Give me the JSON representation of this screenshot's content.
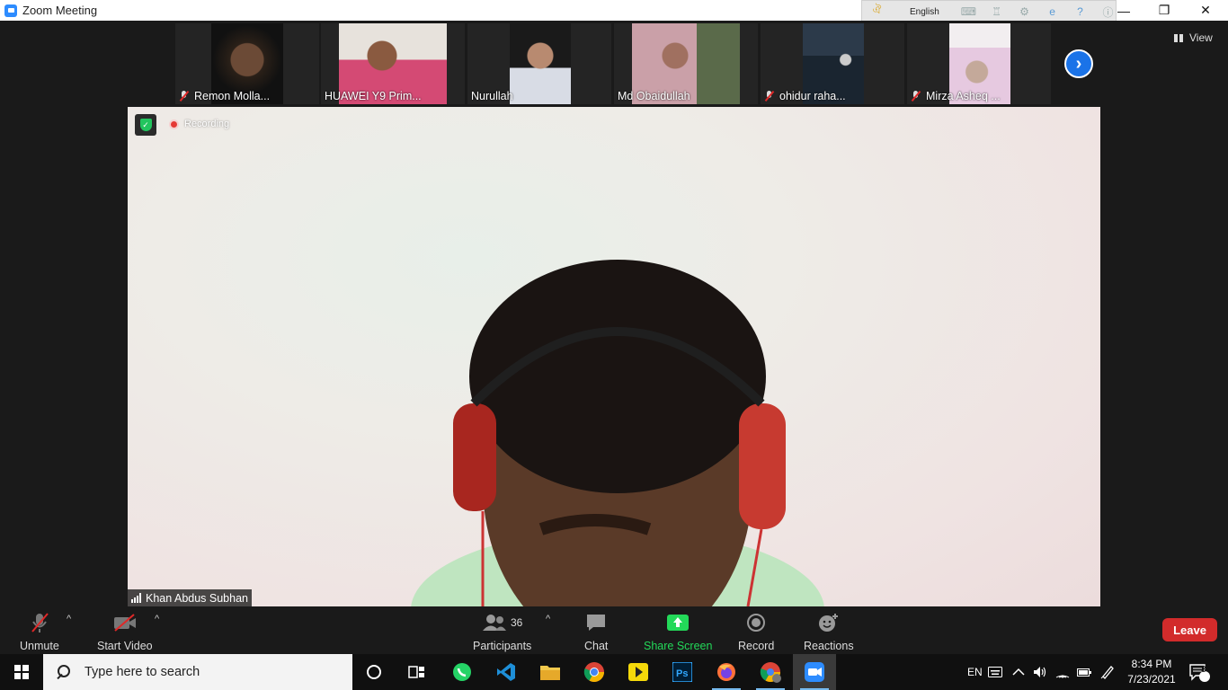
{
  "window": {
    "title": "Zoom Meeting",
    "language": "English",
    "minimize": "—",
    "restore": "❐",
    "close": "✕"
  },
  "participants_strip": [
    {
      "name": "Remon Molla...",
      "muted": true
    },
    {
      "name": "HUAWEI Y9 Prim...",
      "muted": false
    },
    {
      "name": "Nurullah",
      "muted": false
    },
    {
      "name": "Md Obaidullah",
      "muted": false
    },
    {
      "name": "ohidur raha...",
      "muted": true
    },
    {
      "name": "Mirza Asheq ...",
      "muted": true
    }
  ],
  "view_label": "View",
  "main_video": {
    "recording_label": "Recording",
    "speaker_name": "Khan Abdus Subhan"
  },
  "toolbar": {
    "unmute_label": "Unmute",
    "start_video_label": "Start Video",
    "participants_count": "36",
    "participants_label": "Participants",
    "chat_label": "Chat",
    "share_screen_label": "Share Screen",
    "record_label": "Record",
    "reactions_label": "Reactions",
    "leave_label": "Leave",
    "share_color": "#23d959",
    "leave_color": "#d22b2b"
  },
  "taskbar": {
    "search_placeholder": "Type here to search",
    "apps": [
      "cortana",
      "task-view",
      "whatsapp",
      "vscode",
      "file-explorer",
      "chrome",
      "kmplayer",
      "photoshop",
      "firefox",
      "chrome-profile",
      "zoom"
    ],
    "tray_language": "EN",
    "time": "8:34 PM",
    "date": "7/23/2021",
    "notification_count": "3"
  }
}
